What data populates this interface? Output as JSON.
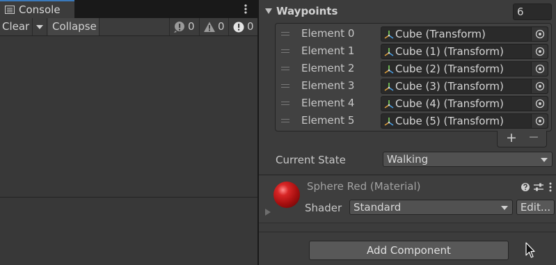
{
  "console": {
    "tab_label": "Console",
    "clear_label": "Clear",
    "collapse_label": "Collapse",
    "counters": {
      "log": "0",
      "warnings": "0",
      "errors": "0"
    }
  },
  "inspector": {
    "waypoints": {
      "title": "Waypoints",
      "count": "6",
      "elements": [
        {
          "label": "Element 0",
          "value": "Cube (Transform)"
        },
        {
          "label": "Element 1",
          "value": "Cube (1) (Transform)"
        },
        {
          "label": "Element 2",
          "value": "Cube (2) (Transform)"
        },
        {
          "label": "Element 3",
          "value": "Cube (3) (Transform)"
        },
        {
          "label": "Element 4",
          "value": "Cube (4) (Transform)"
        },
        {
          "label": "Element 5",
          "value": "Cube (5) (Transform)"
        }
      ],
      "add_label": "+",
      "remove_label": "−"
    },
    "current_state": {
      "label": "Current State",
      "value": "Walking"
    },
    "material": {
      "title": "Sphere Red (Material)",
      "shader_label": "Shader",
      "shader_value": "Standard",
      "edit_label": "Edit..."
    },
    "add_component_label": "Add Component"
  },
  "icons": {
    "console_tab": "console-list-icon",
    "log": "info-icon",
    "warning": "warning-icon",
    "error": "error-icon",
    "transform": "transform-axes-icon",
    "object_picker": "object-picker-icon",
    "help": "help-icon",
    "presets": "presets-icon",
    "menu": "kebab-menu-icon"
  },
  "colors": {
    "accent": "#3a79bb",
    "material_sphere": "#c01818"
  }
}
